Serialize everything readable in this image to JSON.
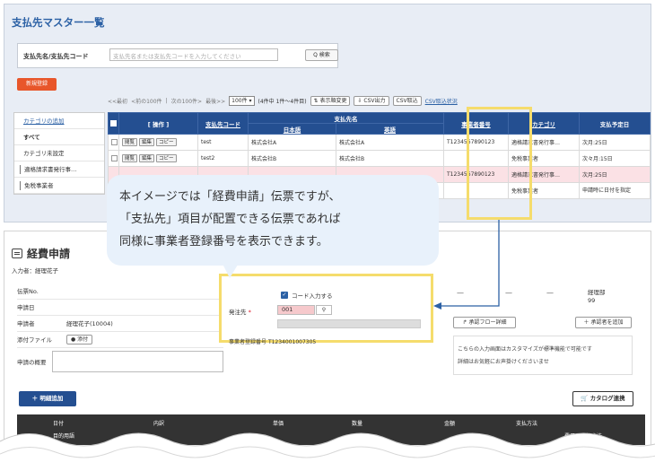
{
  "top": {
    "title": "支払先マスター一覧",
    "search_label": "支払先名/支払先コード",
    "search_placeholder": "支払先名または支払先コードを入力してください",
    "search_button": "Q 検索",
    "new_button": "新規登録",
    "pager": {
      "first": "<<最初",
      "prev": "<前の100件",
      "sep": "|",
      "next": "次の100件>",
      "last": "最後>>",
      "per_page": "100件 ▾",
      "count": "(4件中 1件〜4件目)",
      "sort_button": "⇅ 表示順変更",
      "csv_out": "⇩ CSV出力",
      "csv_in": "CSV取込",
      "csv_status": "CSV取込状況"
    },
    "sidebar": [
      {
        "label": "カテゴリの追加",
        "type": "link"
      },
      {
        "label": "すべて",
        "type": "active"
      },
      {
        "label": "カテゴリ未設定",
        "type": "normal"
      },
      {
        "label": "適格請求書発行事…",
        "type": "sub"
      },
      {
        "label": "免税事業者",
        "type": "sub"
      }
    ],
    "table": {
      "headers": {
        "ops": "[ 操作 ]",
        "code": "支払先コード",
        "name": "支払先名",
        "name_ja": "日本語",
        "name_en": "英語",
        "reg_no": "事業者番号",
        "category": "カテゴリ",
        "due": "支払予定日"
      },
      "op_buttons": [
        "閲覧",
        "編集",
        "コピー"
      ],
      "rows": [
        {
          "code": "test",
          "ja": "株式会社A",
          "en": "株式会社A",
          "reg": "T1234567890123",
          "cat": "適格請求書発行事…",
          "due": "次月:25日",
          "style": "normal"
        },
        {
          "code": "test2",
          "ja": "株式会社B",
          "en": "株式会社B",
          "reg": "",
          "cat": "免税事業者",
          "due": "次々月:15日",
          "style": "normal"
        },
        {
          "code": "",
          "ja": "",
          "en": "",
          "reg": "T1234567890123",
          "cat": "適格請求書発行事…",
          "due": "次月:25日",
          "style": "pink"
        },
        {
          "code": "",
          "ja": "",
          "en": "",
          "reg": "",
          "cat": "免税事業者",
          "due": "申請時に日付を指定",
          "style": "normal"
        }
      ]
    }
  },
  "callout": {
    "line1": "本イメージでは「経費申請」伝票ですが、",
    "line2": "「支払先」項目が配置できる伝票であれば",
    "line3": "同様に事業者登録番号を表示できます。"
  },
  "form": {
    "title": "経費申請",
    "inputter": "入力者：経理花子",
    "rows": [
      {
        "label": "伝票No.",
        "value": ""
      },
      {
        "label": "申請日",
        "value": ""
      },
      {
        "label": "申請者",
        "value": "経理花子(10004)"
      },
      {
        "label": "添付ファイル",
        "value": ""
      }
    ],
    "attach_button": "添付",
    "memo_label": "申請の概要",
    "code_input_label": "コード入力する",
    "payee_label": "発注先",
    "required_mark": "*",
    "payee_code": "001",
    "reg_label": "事業者登録番号",
    "reg_value": "T1234001007305",
    "dashes": [
      "—",
      "—",
      "—"
    ],
    "dept_line1": "経理部",
    "dept_line2": "99",
    "approve_flow_button": "承認フロー詳細",
    "add_approver_button": "＋ 承認者を追加",
    "note_line1": "こちらの入力画面はカスタマイズが標準機能で可能です",
    "note_line2": "詳細はお気軽にお声掛けくださいませ",
    "add_detail_button": "＋ 明細追加",
    "catalog_button": "カタログ連携",
    "detail_headers": [
      "日付",
      "内訳",
      "単価",
      "数量",
      "金額",
      "支払方法"
    ],
    "detail_headers2": [
      "目的用語",
      "費用の支払方法"
    ]
  },
  "colors": {
    "brand_blue": "#244f91",
    "accent_orange": "#e8562a",
    "highlight_yellow": "#f5dc6c",
    "callout_bg": "#e8f1fb"
  }
}
